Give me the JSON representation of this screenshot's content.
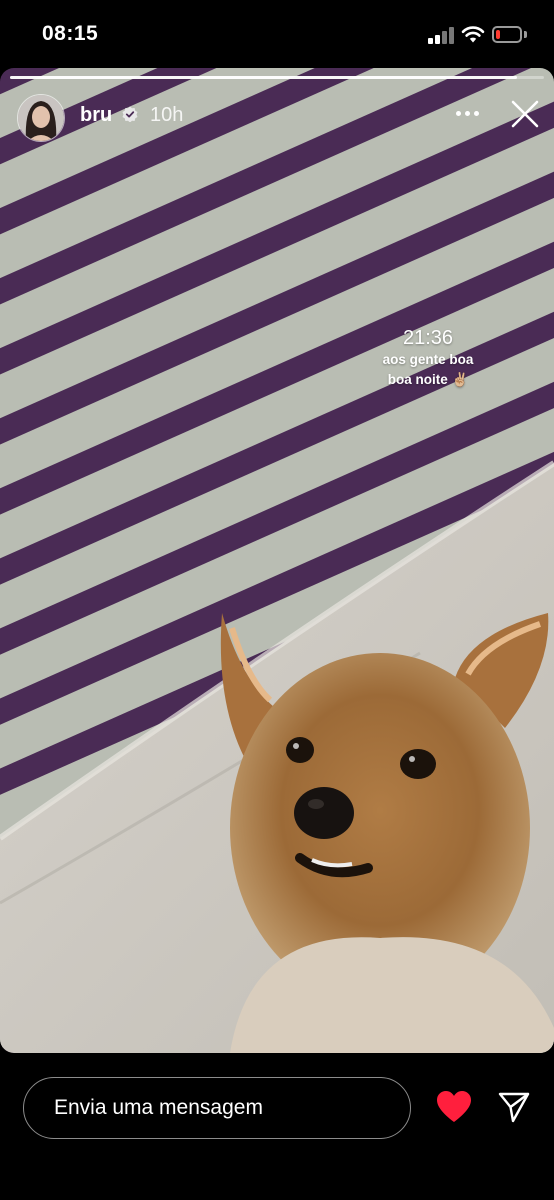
{
  "status_bar": {
    "time": "08:15",
    "battery_level": 0.2,
    "battery_color": "#ff3b30"
  },
  "story": {
    "progress": 0.95,
    "user": {
      "username": "bru",
      "verified": true,
      "time_ago": "10h"
    },
    "caption": {
      "time": "21:36",
      "line1": "aos gente boa",
      "line2": "boa noite ✌🏼"
    },
    "icons": [
      "more-icon",
      "close-icon",
      "verified-badge-icon"
    ]
  },
  "reply_bar": {
    "placeholder": "Envia uma mensagem",
    "heart_color": "#ff1f3d"
  }
}
